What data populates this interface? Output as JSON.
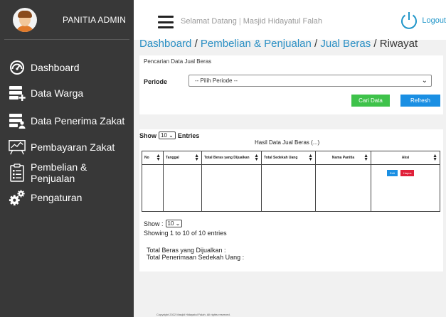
{
  "sidebar": {
    "title": "PANITIA ADMIN",
    "items": [
      {
        "label": "Dashboard",
        "icon": "speedometer-icon"
      },
      {
        "label": "Data Warga",
        "icon": "database-add-icon"
      },
      {
        "label": "Data Penerima Zakat",
        "icon": "database-user-icon"
      },
      {
        "label": "Pembayaran Zakat",
        "icon": "chart-board-icon"
      },
      {
        "label": "Pembelian & Penjualan",
        "icon": "clipboard-list-icon"
      },
      {
        "label": "Pengaturan",
        "icon": "gears-icon"
      }
    ]
  },
  "topbar": {
    "welcome": "Selamat Datang",
    "separator": "|",
    "site": "Masjid Hidayatul Falah",
    "logout": "Logout"
  },
  "breadcrumb": {
    "dashboard": "Dashboard",
    "sep": "/",
    "pembelian": "Pembelian & Penjualan",
    "jual": "Jual Beras",
    "riwayat": "Riwayat"
  },
  "search": {
    "title": "Pencarian Data Jual Beras",
    "periode_label": "Periode",
    "periode_value": "-- Pilih Periode --",
    "cari_button": "Cari Data",
    "refresh_button": "Refresh"
  },
  "results": {
    "show_label": "Show",
    "entries_label": "Entries",
    "page_size": "10",
    "title": "Hasil Data Jual Beras (...)",
    "columns": [
      "No",
      "Tanggal",
      "Total Beras yang Dijualkan",
      "Total Sedekah Uang",
      "Nama Panitia",
      "Aksi"
    ],
    "edit_label": "Edit",
    "hapus_label": "Hapus",
    "show_bottom_label": "Show :",
    "showing_text": "Showing 1 to 10 of 10 entries",
    "total_beras_label": "Total Beras yang Dijualkan  :",
    "total_sedekah_label": "Total Penerimaan Sedekah Uang :"
  },
  "footer": {
    "text": "Copyright     2022 Masjid Hidayatul Falah. All rights reserved."
  },
  "colors": {
    "sidebar_bg": "#383838",
    "accent_link": "#2a8fc4",
    "cari_green": "#3ec24a",
    "refresh_blue": "#1a8fe3",
    "hapus_red": "#e0203a"
  }
}
